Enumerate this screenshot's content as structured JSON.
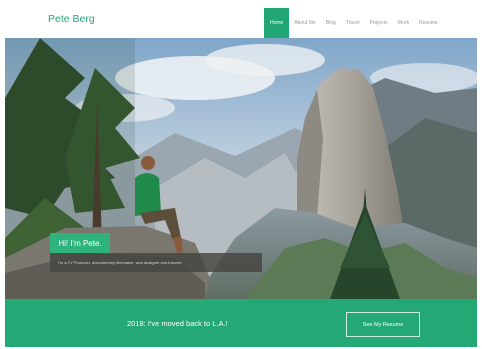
{
  "site": {
    "brand": "Pete Berg"
  },
  "nav": {
    "items": [
      {
        "label": "Home",
        "active": true
      },
      {
        "label": "About Me",
        "active": false
      },
      {
        "label": "Blog",
        "active": false
      },
      {
        "label": "Travel",
        "active": false
      },
      {
        "label": "Projects",
        "active": false
      },
      {
        "label": "Work",
        "active": false
      },
      {
        "label": "Resume",
        "active": false
      }
    ]
  },
  "hero": {
    "greeting": "Hi! I'm Pete.",
    "tagline": "I'm a TV Producer, documentary filmmaker, web designer and traveler."
  },
  "banner": {
    "announcement": "2018: I've moved back to L.A.!",
    "button_label": "See My Resume"
  },
  "colors": {
    "accent": "#24a876",
    "brand_text": "#2aa87a",
    "tagline_bg": "#46443f"
  }
}
